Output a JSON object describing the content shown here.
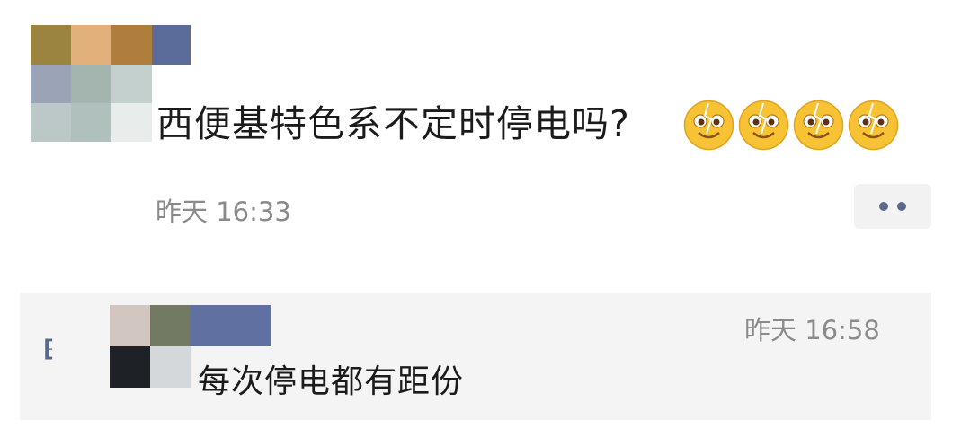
{
  "post": {
    "text": "西便基特色系不定时停电吗?",
    "emoji_icon": "sweating-smile-emoji",
    "emoji_count": 4,
    "time": "昨天 16:33"
  },
  "colors": {
    "author_link": "#57688c",
    "meta_text": "#8a8a8a",
    "comment_bg": "#f4f4f4",
    "more_button_bg": "#f2f2f2"
  },
  "comment": {
    "icon": "comment-quote-icon",
    "icon_glyph": "⁅",
    "time": "昨天 16:58",
    "text": "每次停电都有距份"
  }
}
